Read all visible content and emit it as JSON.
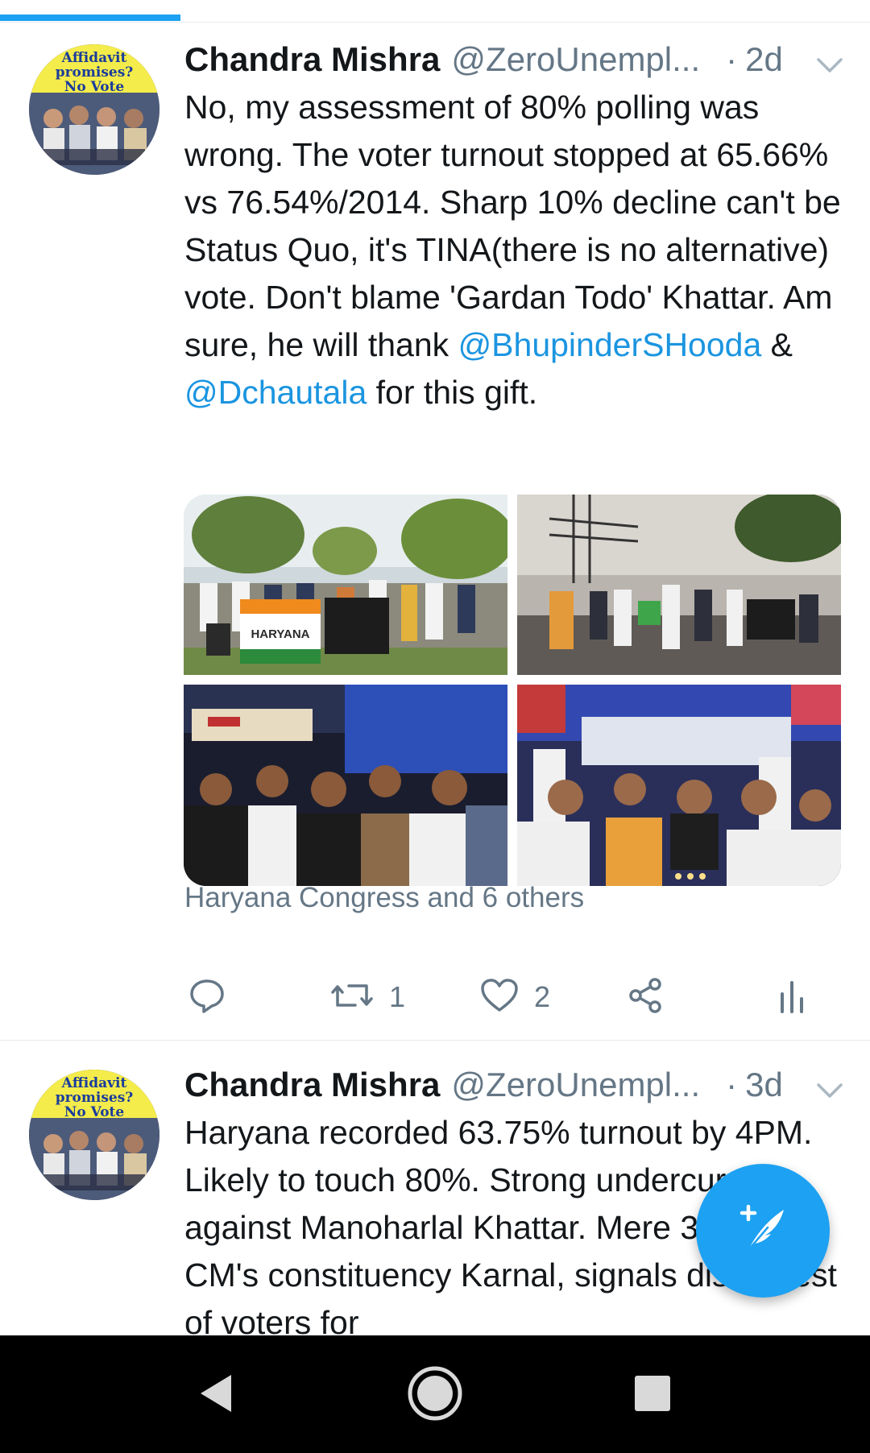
{
  "tweets": [
    {
      "author": "Chandra Mishra",
      "handle": "@ZeroUnempl...",
      "separator": "·",
      "time": "2d",
      "text_segments": [
        {
          "text": "No, my assessment of 80% polling was wrong. The voter turnout stopped at 65.66% vs 76.54%/2014. Sharp 10% decline can't be Status Quo, it's TINA(there is no alternative) vote. Don't blame 'Gardan Todo' Khattar. Am sure, he will thank "
        },
        {
          "text": "@BhupinderSHooda",
          "mention": true
        },
        {
          "text": " & "
        },
        {
          "text": "@Dchautala",
          "mention": true
        },
        {
          "text": " for this gift."
        }
      ],
      "avatar_text": [
        "Affidavit",
        "promises?",
        "No Vote"
      ],
      "photo_banner_text": "HARYANA",
      "liked_by": "Haryana Congress and 6 others",
      "actions": {
        "reply": {
          "icon": "reply-icon",
          "count": ""
        },
        "retweet": {
          "icon": "retweet-icon",
          "count": "1"
        },
        "like": {
          "icon": "heart-icon",
          "count": "2"
        },
        "share": {
          "icon": "share-icon",
          "count": ""
        },
        "analytics": {
          "icon": "analytics-icon",
          "count": ""
        }
      }
    },
    {
      "author": "Chandra Mishra",
      "handle": "@ZeroUnempl...",
      "separator": "·",
      "time": "3d",
      "text": "Haryana recorded 63.75% turnout by 4PM. Likely to touch 80%. Strong undercurrent against Manoharlal Khattar. Mere 39.30% in CM's constituency Karnal, signals disinterest of voters for",
      "avatar_text": [
        "Affidavit",
        "promises?",
        "No Vote"
      ]
    }
  ],
  "fab": {
    "icon": "compose-tweet-icon"
  },
  "navbar": {
    "back": "back-icon",
    "home": "home-icon",
    "recents": "recents-icon"
  },
  "colors": {
    "accent": "#1da1f2",
    "mention": "#1b95e0",
    "secondary_text": "#657786",
    "divider": "#e6ecf0"
  }
}
